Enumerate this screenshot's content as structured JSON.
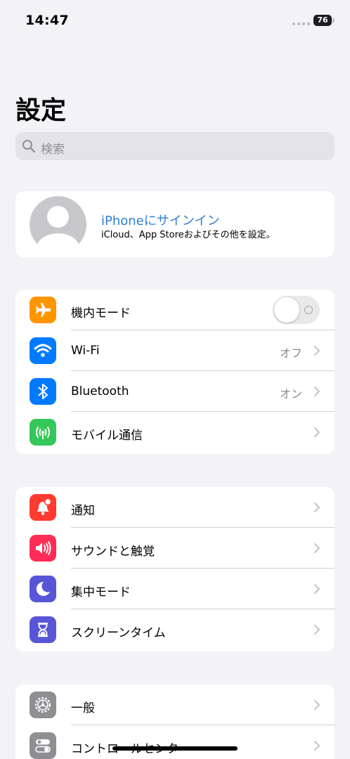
{
  "status_bar": {
    "time": "14:47",
    "battery": "76"
  },
  "page_title": "設定",
  "search": {
    "placeholder": "検索"
  },
  "profile": {
    "title": "iPhoneにサインイン",
    "subtitle": "iCloud、App Storeおよびその他を設定。"
  },
  "section1": [
    {
      "label": "機内モード",
      "icon": "airplane-icon",
      "color": "#ff9500",
      "toggle": false
    },
    {
      "label": "Wi-Fi",
      "icon": "wifi-icon",
      "color": "#007aff",
      "value": "オフ"
    },
    {
      "label": "Bluetooth",
      "icon": "bluetooth-icon",
      "color": "#007aff",
      "value": "オン"
    },
    {
      "label": "モバイル通信",
      "icon": "antenna-icon",
      "color": "#34c759"
    }
  ],
  "section2": [
    {
      "label": "通知",
      "icon": "notification-icon",
      "color": "#ff3b30"
    },
    {
      "label": "サウンドと触覚",
      "icon": "speaker-icon",
      "color": "#ff2d55"
    },
    {
      "label": "集中モード",
      "icon": "moon-icon",
      "color": "#5856d6"
    },
    {
      "label": "スクリーンタイム",
      "icon": "hourglass-icon",
      "color": "#5856d6"
    }
  ],
  "section3": [
    {
      "label": "一般",
      "icon": "gear-icon",
      "color": "#8e8e93"
    },
    {
      "label": "コントロールセンター",
      "icon": "switches-icon",
      "color": "#8e8e93"
    }
  ]
}
